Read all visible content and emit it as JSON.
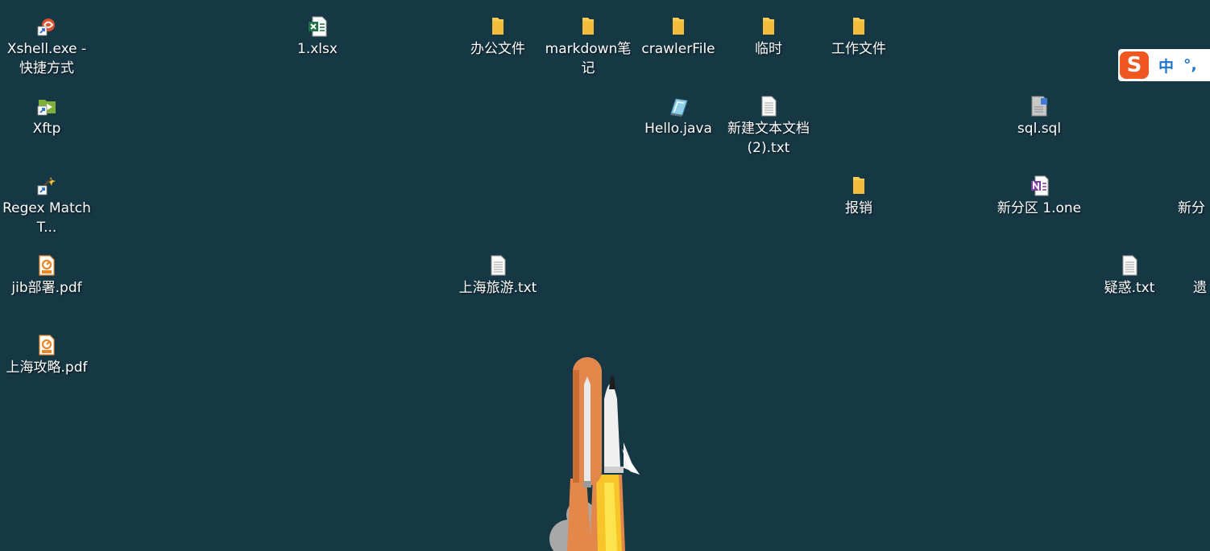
{
  "desktop": {
    "background_color": "#163845",
    "icons": [
      {
        "label": "Xshell.exe - 快捷方式",
        "icon": "xshell-shortcut-icon"
      },
      {
        "label": "1.xlsx",
        "icon": "excel-file-icon"
      },
      {
        "label": "办公文件",
        "icon": "folder-icon"
      },
      {
        "label": "markdown笔记",
        "icon": "folder-icon"
      },
      {
        "label": "crawlerFile",
        "icon": "folder-icon"
      },
      {
        "label": "临时",
        "icon": "folder-icon"
      },
      {
        "label": "工作文件",
        "icon": "folder-icon"
      },
      {
        "label": "Xftp",
        "icon": "xftp-shortcut-icon"
      },
      {
        "label": "Hello.java",
        "icon": "java-file-icon"
      },
      {
        "label": "新建文本文档(2).txt",
        "icon": "text-file-icon"
      },
      {
        "label": "sql.sql",
        "icon": "sql-file-icon"
      },
      {
        "label": "Regex Match T...",
        "icon": "regex-shortcut-icon"
      },
      {
        "label": "报销",
        "icon": "folder-icon"
      },
      {
        "label": "新分区 1.one",
        "icon": "onenote-file-icon"
      },
      {
        "label": "新分",
        "icon": "onenote-file-icon"
      },
      {
        "label": "jib部署.pdf",
        "icon": "pdf-file-icon"
      },
      {
        "label": "上海旅游.txt",
        "icon": "text-file-icon"
      },
      {
        "label": "疑惑.txt",
        "icon": "text-file-icon"
      },
      {
        "label": "遗",
        "icon": "text-file-icon"
      },
      {
        "label": "上海攻略.pdf",
        "icon": "pdf-file-icon"
      }
    ]
  },
  "ime_bar": {
    "logo": "S",
    "mode": "中",
    "punct": "°,"
  },
  "colors": {
    "folder": "#f7cf55",
    "excel": "#1e7145",
    "pdf": "#e8862a",
    "onenote": "#7b3fa0",
    "sogou": "#f0561f",
    "rocket_orange": "#e3884a",
    "rocket_yellow": "#f7c52a"
  }
}
